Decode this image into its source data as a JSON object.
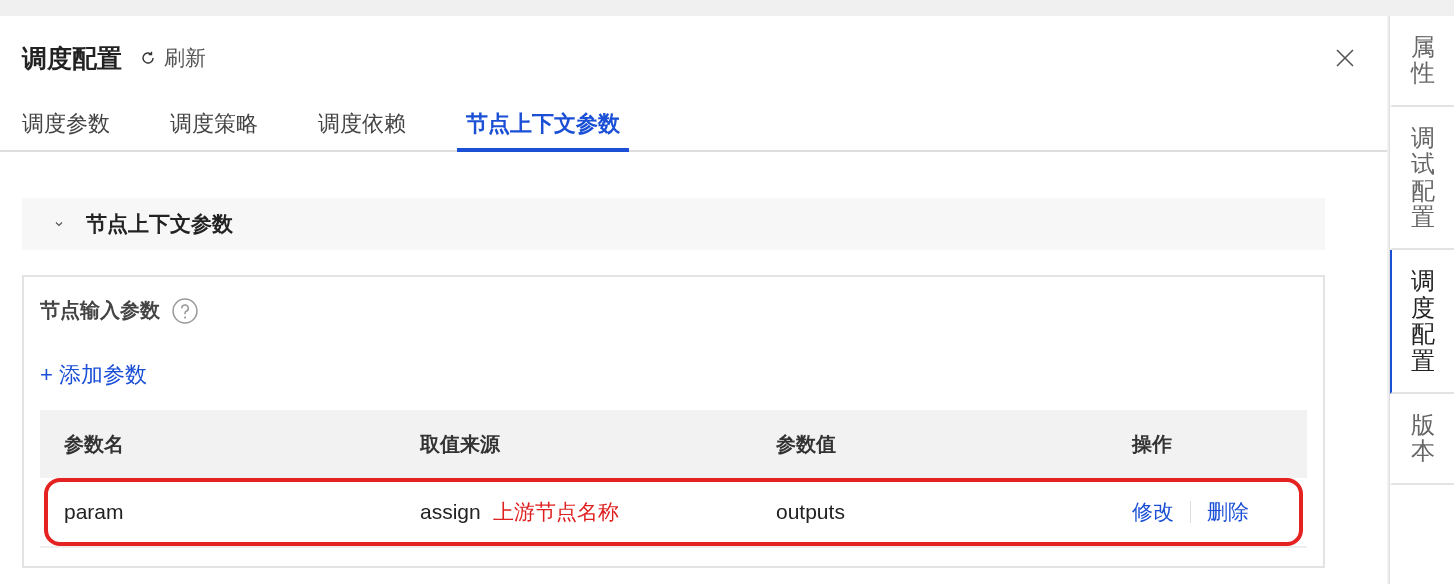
{
  "panel": {
    "title": "调度配置",
    "refresh": "刷新"
  },
  "tabs": [
    {
      "label": "调度参数",
      "selected": false
    },
    {
      "label": "调度策略",
      "selected": false
    },
    {
      "label": "调度依赖",
      "selected": false
    },
    {
      "label": "节点上下文参数",
      "selected": true
    }
  ],
  "section": {
    "title": "节点上下文参数",
    "expanded": true
  },
  "card": {
    "title": "节点输入参数",
    "add_link": "+ 添加参数"
  },
  "table": {
    "columns": [
      "参数名",
      "取值来源",
      "参数值",
      "操作"
    ],
    "rows": [
      {
        "name": "param",
        "source": "assign",
        "note": "上游节点名称",
        "value": "outputs",
        "actions": [
          "修改",
          "删除"
        ],
        "highlighted": true
      }
    ]
  },
  "side_tabs": [
    {
      "label": "属性",
      "selected": false
    },
    {
      "label": "调试配置",
      "selected": false
    },
    {
      "label": "调度配置",
      "selected": true
    },
    {
      "label": "版本",
      "selected": false
    }
  ]
}
